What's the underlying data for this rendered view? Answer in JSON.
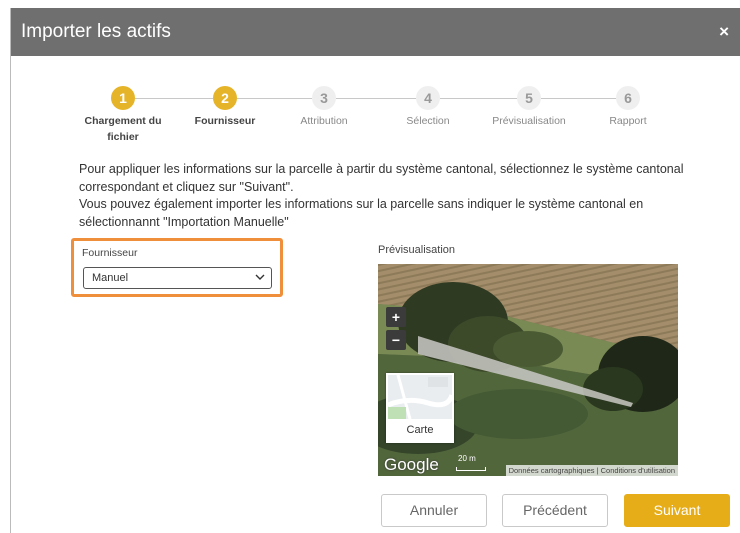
{
  "dialog": {
    "title": "Importer les actifs",
    "close_label": "×"
  },
  "steps": [
    {
      "number": "1",
      "label": "Chargement du fichier",
      "state": "done"
    },
    {
      "number": "2",
      "label": "Fournisseur",
      "state": "active"
    },
    {
      "number": "3",
      "label": "Attribution",
      "state": "todo"
    },
    {
      "number": "4",
      "label": "Sélection",
      "state": "todo"
    },
    {
      "number": "5",
      "label": "Prévisualisation",
      "state": "todo"
    },
    {
      "number": "6",
      "label": "Rapport",
      "state": "todo"
    }
  ],
  "instructions": {
    "line1": "Pour appliquer les informations sur la parcelle à partir du système cantonal, sélectionnez le système cantonal correspondant et cliquez sur \"Suivant\".",
    "line2": "Vous pouvez également importer les informations sur la parcelle sans indiquer le système cantonal en sélectionnannt \"Importation Manuelle\""
  },
  "supplier": {
    "label": "Fournisseur",
    "selected": "Manuel"
  },
  "preview": {
    "label": "Prévisualisation",
    "zoom_in": "+",
    "zoom_out": "−",
    "map_type_label": "Carte",
    "google_logo": "Google",
    "scale_label": "20 m",
    "attribution": "Données cartographiques | Conditions d'utilisation"
  },
  "buttons": {
    "cancel": "Annuler",
    "previous": "Précédent",
    "next": "Suivant"
  },
  "colors": {
    "accent": "#e6b429",
    "highlight_border": "#ef8f3c",
    "titlebar": "#6f6f6f"
  }
}
